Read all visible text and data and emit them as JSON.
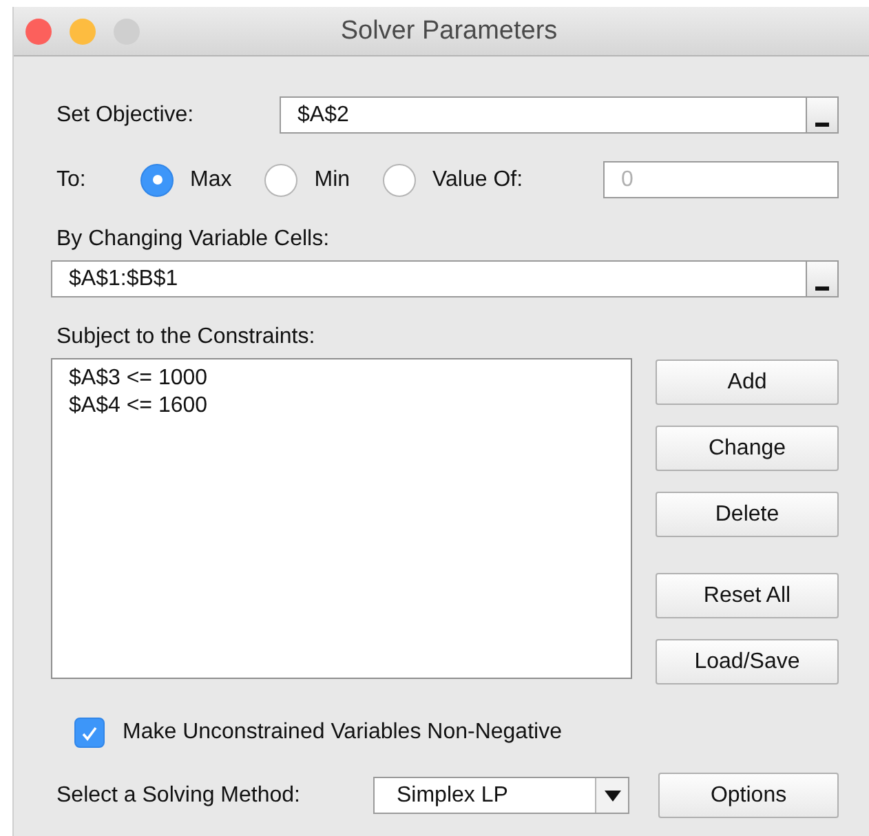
{
  "window": {
    "title": "Solver Parameters"
  },
  "objective": {
    "label": "Set Objective:",
    "value": "$A$2"
  },
  "to": {
    "label": "To:",
    "options": [
      {
        "label": "Max",
        "selected": true
      },
      {
        "label": "Min",
        "selected": false
      },
      {
        "label": "Value Of:",
        "selected": false
      }
    ],
    "value_of": {
      "placeholder": "0"
    }
  },
  "variable_cells": {
    "label": "By Changing Variable Cells:",
    "value": "$A$1:$B$1"
  },
  "constraints": {
    "label": "Subject to the Constraints:",
    "items": [
      "$A$3 <= 1000",
      "$A$4 <= 1600"
    ]
  },
  "constraint_buttons": [
    "Add",
    "Change",
    "Delete",
    "Reset All",
    "Load/Save"
  ],
  "non_negative": {
    "label": "Make Unconstrained Variables Non-Negative",
    "checked": true
  },
  "method": {
    "label": "Select a Solving Method:",
    "value": "Simplex LP"
  },
  "options_button": "Options"
}
